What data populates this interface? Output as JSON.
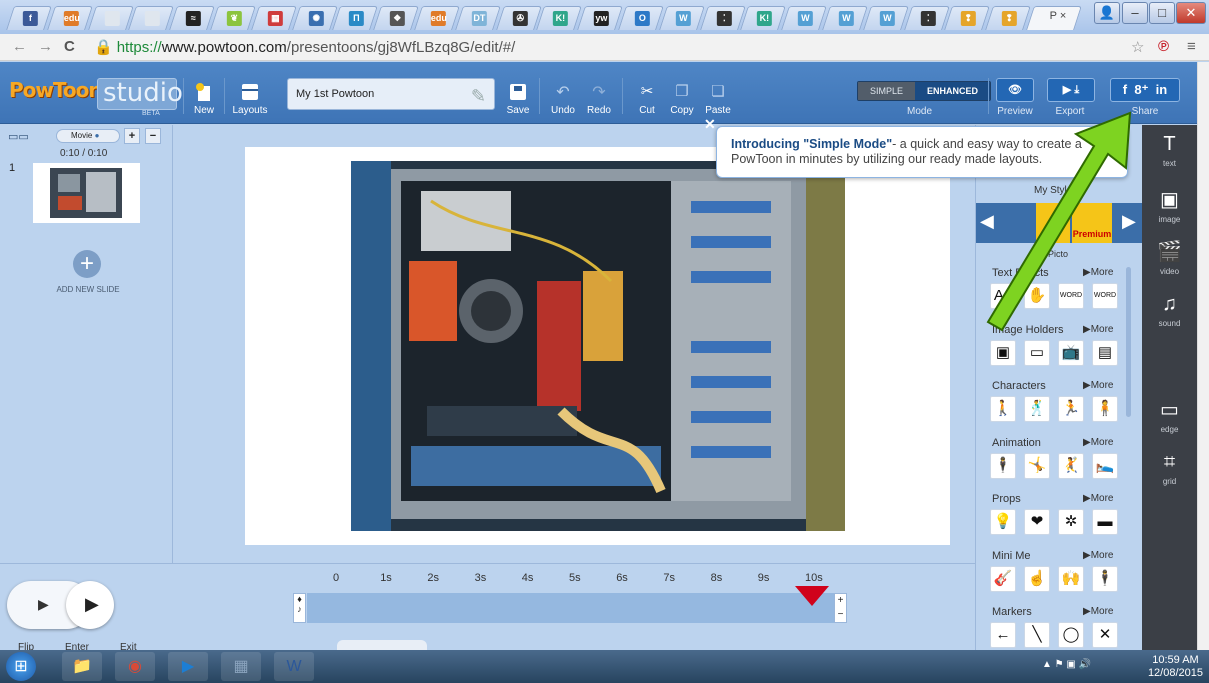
{
  "browser": {
    "tabs": [
      {
        "icon": "facebook-icon",
        "color": "#3b5998",
        "glyph": "f"
      },
      {
        "icon": "edu-icon",
        "color": "#e07b28",
        "glyph": "edu"
      },
      {
        "icon": "blank-page-icon",
        "color": "#dfe6ee",
        "glyph": ""
      },
      {
        "icon": "blank-page-icon",
        "color": "#dfe6ee",
        "glyph": ""
      },
      {
        "icon": "sc-icon",
        "color": "#222222",
        "glyph": "≈"
      },
      {
        "icon": "leaf-icon",
        "color": "#8cc43e",
        "glyph": "❦"
      },
      {
        "icon": "calendar-icon",
        "color": "#cf3c3c",
        "glyph": "▦"
      },
      {
        "icon": "compass-icon",
        "color": "#3a6fb0",
        "glyph": "✺"
      },
      {
        "icon": "pi-icon",
        "color": "#2a8ac6",
        "glyph": "Π"
      },
      {
        "icon": "paw-icon",
        "color": "#555555",
        "glyph": "❖"
      },
      {
        "icon": "edu-icon",
        "color": "#e07b28",
        "glyph": "edu"
      },
      {
        "icon": "dt-icon",
        "color": "#7fb4d8",
        "glyph": "DT"
      },
      {
        "icon": "accessibility-icon",
        "color": "#333333",
        "glyph": "✇"
      },
      {
        "icon": "kahoot-icon",
        "color": "#2fa68b",
        "glyph": "K!"
      },
      {
        "icon": "yw-icon",
        "color": "#222222",
        "glyph": "yw"
      },
      {
        "icon": "office-icon",
        "color": "#2d79c7",
        "glyph": "O"
      },
      {
        "icon": "w-icon",
        "color": "#54a0d4",
        "glyph": "W"
      },
      {
        "icon": "dots-icon",
        "color": "#333333",
        "glyph": "⁚"
      },
      {
        "icon": "kahoot-icon",
        "color": "#2fa68b",
        "glyph": "K!"
      },
      {
        "icon": "w-icon",
        "color": "#54a0d4",
        "glyph": "W"
      },
      {
        "icon": "w-icon",
        "color": "#54a0d4",
        "glyph": "W"
      },
      {
        "icon": "w-icon",
        "color": "#54a0d4",
        "glyph": "W"
      },
      {
        "icon": "dots-icon",
        "color": "#333333",
        "glyph": "⁚"
      },
      {
        "icon": "character-icon",
        "color": "#e5a52a",
        "glyph": "❢"
      },
      {
        "icon": "character-icon",
        "color": "#e5a52a",
        "glyph": "❢"
      }
    ],
    "active_tab_label": "P ×",
    "url_scheme": "https://",
    "url_host": "www.powtoon.com",
    "url_path": "/presentoons/gj8WfLBzq8G/edit/#/"
  },
  "toolbar": {
    "new_label": "New",
    "layouts_label": "Layouts",
    "presentation_title": "My 1st Powtoon",
    "save_label": "Save",
    "undo_label": "Undo",
    "redo_label": "Redo",
    "cut_label": "Cut",
    "copy_label": "Copy",
    "paste_label": "Paste",
    "mode_simple": "SIMPLE",
    "mode_enhanced": "ENHANCED",
    "mode_label": "Mode",
    "preview_label": "Preview",
    "export_label": "Export",
    "share_label": "Share",
    "logo_text": "PowToon",
    "studio_text": "studio",
    "beta_text": "BETA"
  },
  "slides": {
    "movie_label": "Movie",
    "time": "0:10 / 0:10",
    "slide_number": "1",
    "add_label": "ADD NEW SLIDE"
  },
  "callout": {
    "bold": "Introducing \"Simple Mode\"",
    "text": "- a quick and easy way to create a PowToon in minutes by utilizing our ready made layouts."
  },
  "library": {
    "my_style": "My Style",
    "pictogram": "Picto",
    "premium": "Premium",
    "sections": [
      {
        "title": "Text Effects",
        "more": "▶More",
        "tiles": [
          "Aa",
          "✋",
          "WORD",
          "WORD"
        ]
      },
      {
        "title": "Image Holders",
        "more": "▶More",
        "tiles": [
          "▣",
          "▭",
          "📺",
          "▤"
        ]
      },
      {
        "title": "Characters",
        "more": "▶More",
        "tiles": [
          "🚶",
          "🕺",
          "🏃",
          "🧍"
        ]
      },
      {
        "title": "Animation",
        "more": "▶More",
        "tiles": [
          "🕴",
          "🤸",
          "🤾",
          "🛌"
        ]
      },
      {
        "title": "Props",
        "more": "▶More",
        "tiles": [
          "💡",
          "❤",
          "✲",
          "▬"
        ]
      },
      {
        "title": "Mini Me",
        "more": "▶More",
        "tiles": [
          "🎸",
          "☝",
          "🙌",
          "🕴"
        ]
      },
      {
        "title": "Markers",
        "more": "▶More",
        "tiles": [
          "←",
          "╲",
          "◯",
          "✕"
        ]
      }
    ]
  },
  "tools": [
    {
      "icon": "text-icon",
      "glyph": "T",
      "label": "text"
    },
    {
      "icon": "image-icon",
      "glyph": "▣",
      "label": "image"
    },
    {
      "icon": "video-icon",
      "glyph": "🎬",
      "label": "video"
    },
    {
      "icon": "music-note-icon",
      "glyph": "♫",
      "label": "sound"
    },
    {
      "icon": "edge-icon",
      "glyph": "▭",
      "label": "edge"
    },
    {
      "icon": "grid-icon",
      "glyph": "⌗",
      "label": "grid"
    }
  ],
  "timeline": {
    "ticks": [
      "0",
      "1s",
      "2s",
      "3s",
      "4s",
      "5s",
      "6s",
      "7s",
      "8s",
      "9s",
      "10s"
    ],
    "flip_label": "Flip",
    "enter_label": "Enter",
    "exit_label": "Exit",
    "playhead_seconds": 10
  },
  "taskbar": {
    "apps": [
      {
        "icon": "windows-start-icon",
        "color": "#2e7bd0",
        "glyph": "⊞"
      },
      {
        "icon": "file-explorer-icon",
        "color": "#e8c467",
        "glyph": "📁"
      },
      {
        "icon": "chrome-icon",
        "color": "#d84a38",
        "glyph": "◉"
      },
      {
        "icon": "media-player-icon",
        "color": "#1c7ed4",
        "glyph": "▶"
      },
      {
        "icon": "calculator-icon",
        "color": "#8aa3bd",
        "glyph": "▦"
      },
      {
        "icon": "word-icon",
        "color": "#2b579a",
        "glyph": "W"
      }
    ],
    "time": "10:59 AM",
    "date": "12/08/2015"
  },
  "colors": {
    "toolbar_blue": "#4a80c2",
    "panel_bg": "#bcd3ee",
    "arrow_green": "#7ed321",
    "playhead_red": "#d0021b"
  }
}
